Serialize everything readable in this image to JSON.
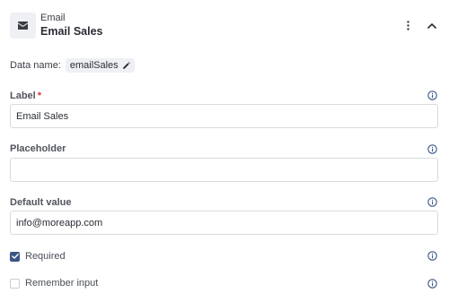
{
  "header": {
    "icon": "envelope-icon",
    "type_label": "Email",
    "title": "Email Sales"
  },
  "data_name": {
    "label": "Data name:",
    "value": "emailSales"
  },
  "fields": {
    "label": {
      "label": "Label",
      "required_mark": "*",
      "value": "Email Sales"
    },
    "placeholder": {
      "label": "Placeholder",
      "value": ""
    },
    "default_value": {
      "label": "Default value",
      "value": "info@moreapp.com"
    }
  },
  "options": {
    "required": {
      "label": "Required",
      "checked": true
    },
    "remember_input": {
      "label": "Remember input",
      "checked": false
    }
  },
  "colors": {
    "accent": "#3a5585",
    "required_star": "#d6383a",
    "icon_box": "#eef0f3"
  }
}
